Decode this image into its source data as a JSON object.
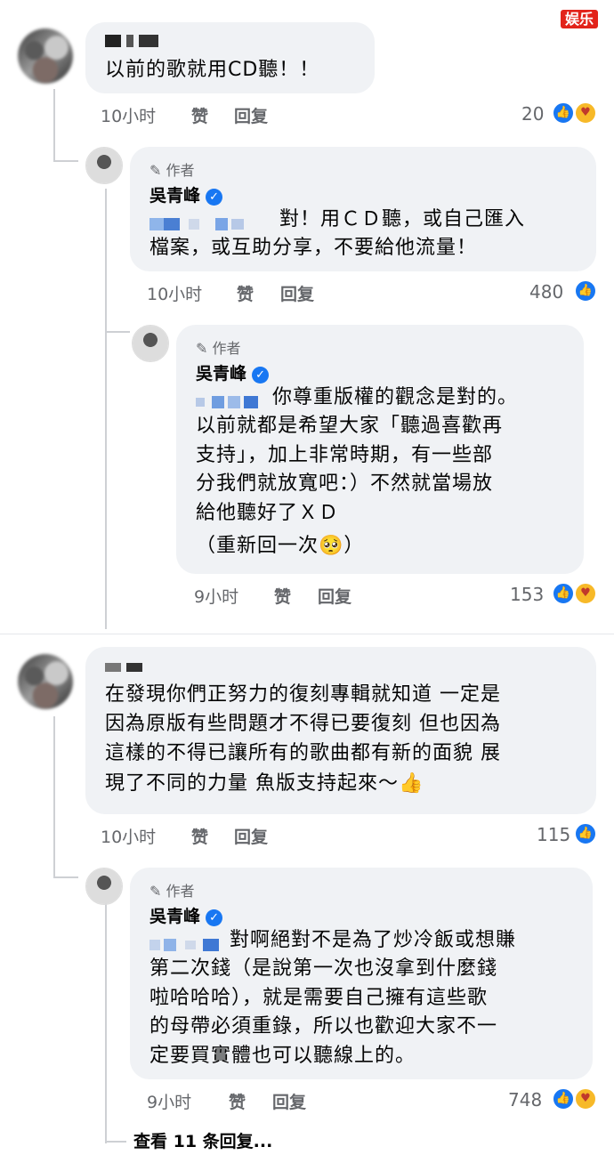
{
  "watermark": "娱乐",
  "actions": {
    "like": "赞",
    "reply": "回复"
  },
  "author_tag": "作者",
  "comments": [
    {
      "time": "10小时",
      "text": "以前的歌就用CD聽！！",
      "count": "20"
    },
    {
      "name": "吳青峰",
      "time": "10小时",
      "lines": [
        "對！用ＣＤ聽，或自己匯入",
        "檔案，或互助分享，不要給他流量！"
      ],
      "count": "480"
    },
    {
      "name": "吳青峰",
      "time": "9小时",
      "lines": [
        "你尊重版權的觀念是對的。",
        "以前就都是希望大家「聽過喜歡再",
        "支持」，加上非常時期，有一些部",
        "分我們就放寬吧：）不然就當場放",
        "給他聽好了ＸＤ",
        "（重新回一次🥺）"
      ],
      "count": "153"
    },
    {
      "time": "10小时",
      "lines": [
        "在發現你們正努力的復刻專輯就知道 一定是",
        "因為原版有些問題才不得已要復刻 但也因為",
        "這樣的不得已讓所有的歌曲都有新的面貌 展",
        "現了不同的力量  魚版支持起來～👍"
      ],
      "count": "115"
    },
    {
      "name": "吳青峰",
      "time": "9小时",
      "lines": [
        "對啊絕對不是為了炒冷飯或想賺",
        "第二次錢（是說第一次也沒拿到什麼錢",
        "啦哈哈哈），就是需要自己擁有這些歌",
        "的母帶必須重錄，所以也歡迎大家不一",
        "定要買實體也可以聽線上的。"
      ],
      "count": "748"
    }
  ],
  "view_more": "查看 11 条回复..."
}
